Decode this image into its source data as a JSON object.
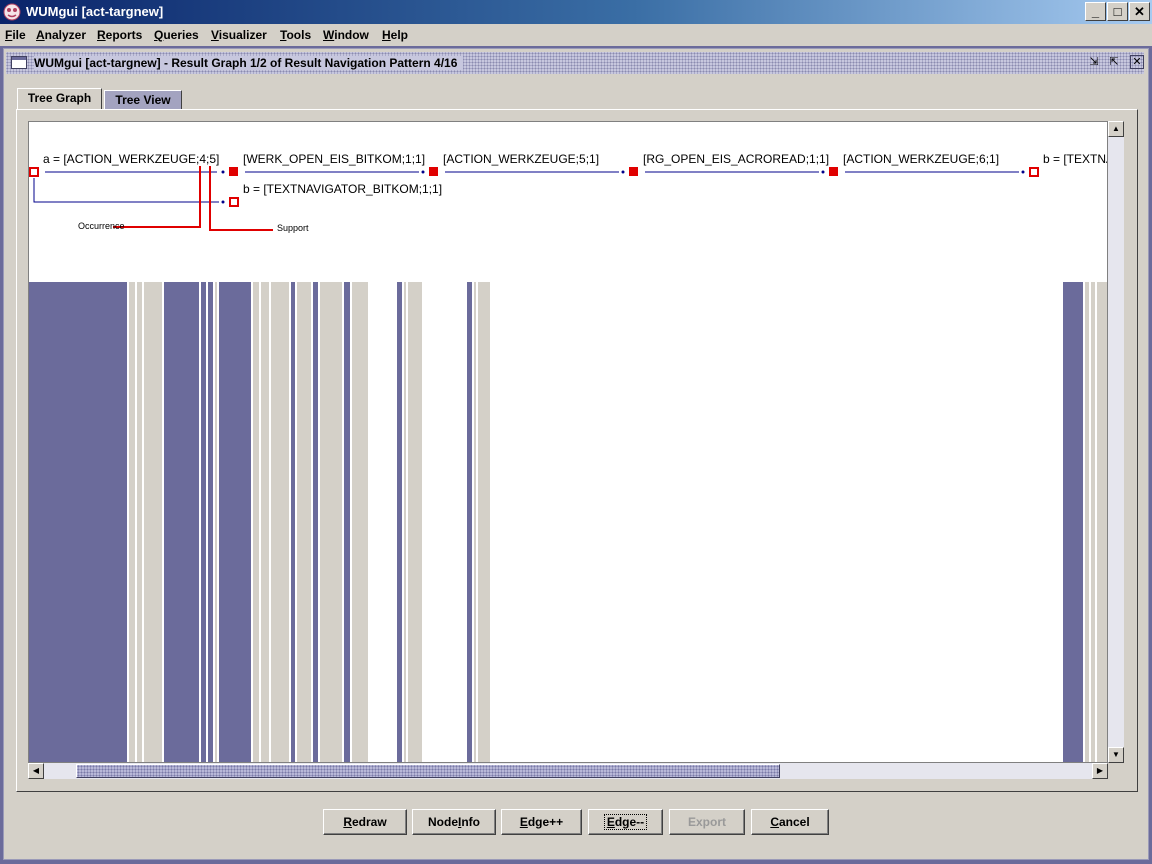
{
  "window": {
    "title": "WUMgui [act-targnew]",
    "controls": {
      "minimize": "_",
      "maximize": "□",
      "close": "✕"
    }
  },
  "menu": [
    {
      "key": "F",
      "rest": "ile"
    },
    {
      "key": "A",
      "rest": "nalyzer"
    },
    {
      "key": "R",
      "rest": "eports"
    },
    {
      "key": "Q",
      "rest": "ueries"
    },
    {
      "key": "V",
      "rest": "isualizer"
    },
    {
      "key": "T",
      "rest": "ools"
    },
    {
      "key": "W",
      "rest": "indow"
    },
    {
      "key": "H",
      "rest": "elp"
    }
  ],
  "frame": {
    "title": "WUMgui [act-targnew] - Result Graph 1/2 of Result Navigation Pattern 4/16"
  },
  "tabs": [
    {
      "label": "Tree Graph",
      "active": true
    },
    {
      "label": "Tree View",
      "active": false
    }
  ],
  "graph": {
    "nodes": {
      "a": "a = [ACTION_WERKZEUGE;4;5]",
      "n1": "[WERK_OPEN_EIS_BITKOM;1;1]",
      "n2": "[ACTION_WERKZEUGE;5;1]",
      "n3": "[RG_OPEN_EIS_ACROREAD;1;1]",
      "n4": "[ACTION_WERKZEUGE;6;1]",
      "n5": "b = [TEXTNA",
      "b": "b = [TEXTNAVIGATOR_BITKOM;1;1]"
    },
    "annotations": {
      "occurrence": "Occurrence",
      "support": "Support"
    }
  },
  "buttons": [
    {
      "key": "R",
      "rest": "edraw",
      "enabled": true
    },
    {
      "pre": "Node",
      "key": "I",
      "rest": "nfo",
      "enabled": true
    },
    {
      "key": "E",
      "rest": "dge++",
      "enabled": true
    },
    {
      "key": "E",
      "rest": "dge--",
      "enabled": true,
      "focused": true
    },
    {
      "key": "E",
      "rest": "xport",
      "enabled": false
    },
    {
      "key": "C",
      "rest": "ancel",
      "enabled": true
    }
  ],
  "colors": {
    "node": "#e00000",
    "edge": "#00008b",
    "annotation": "#e00000",
    "band": "#6b6b9b",
    "band_light": "#d4d0c8"
  }
}
